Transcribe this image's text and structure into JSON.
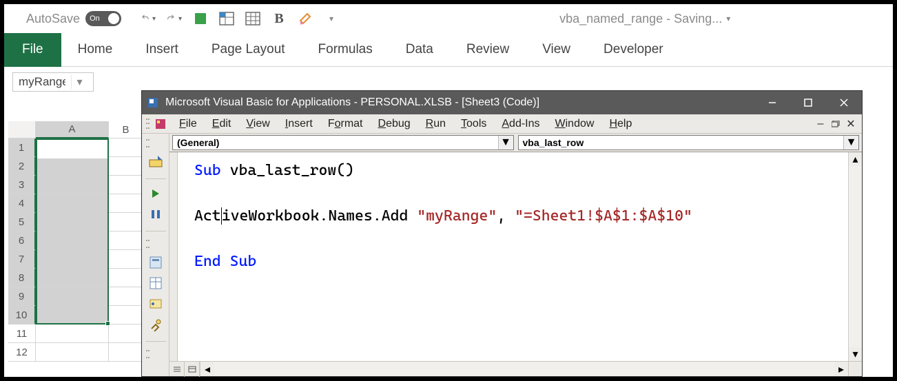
{
  "titlebar": {
    "autosave_label": "AutoSave",
    "autosave_state": "On",
    "doc_title": "vba_named_range - Saving..."
  },
  "ribbon": {
    "file": "File",
    "tabs": [
      "Home",
      "Insert",
      "Page Layout",
      "Formulas",
      "Data",
      "Review",
      "View",
      "Developer"
    ]
  },
  "namebox": {
    "value": "myRange"
  },
  "grid": {
    "cols": [
      "A",
      "B"
    ],
    "row_count": 12,
    "selected_rows": 10
  },
  "vba": {
    "window_title": "Microsoft Visual Basic for Applications - PERSONAL.XLSB - [Sheet3 (Code)]",
    "menus": [
      "File",
      "Edit",
      "View",
      "Insert",
      "Format",
      "Debug",
      "Run",
      "Tools",
      "Add-Ins",
      "Window",
      "Help"
    ],
    "object_dd": "(General)",
    "proc_dd": "vba_last_row",
    "code": {
      "line1_kw": "Sub",
      "line1_rest": " vba_last_row()",
      "line2_pre": "Act",
      "line2_mid": "iveWorkbook.Names.Add ",
      "line2_str1": "\"myRange\"",
      "line2_sep": ", ",
      "line2_str2": "\"=Sheet1!$A$1:$A$10\"",
      "line3": "End Sub"
    }
  }
}
